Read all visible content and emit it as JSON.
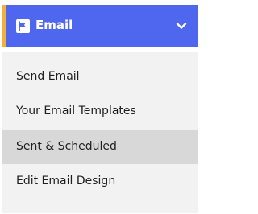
{
  "header": {
    "title": "Email",
    "icon": "email-flag-icon",
    "chevron": "chevron-down-icon",
    "background_color": "#4f67ee",
    "accent_color": "#f4b13a"
  },
  "menu": {
    "items": [
      {
        "label": "Send Email",
        "active": false
      },
      {
        "label": "Your Email Templates",
        "active": false
      },
      {
        "label": "Sent & Scheduled",
        "active": true
      },
      {
        "label": "Edit Email Design",
        "active": false
      }
    ],
    "background_color": "#f2f2f2",
    "active_color": "#d8d8d8"
  }
}
